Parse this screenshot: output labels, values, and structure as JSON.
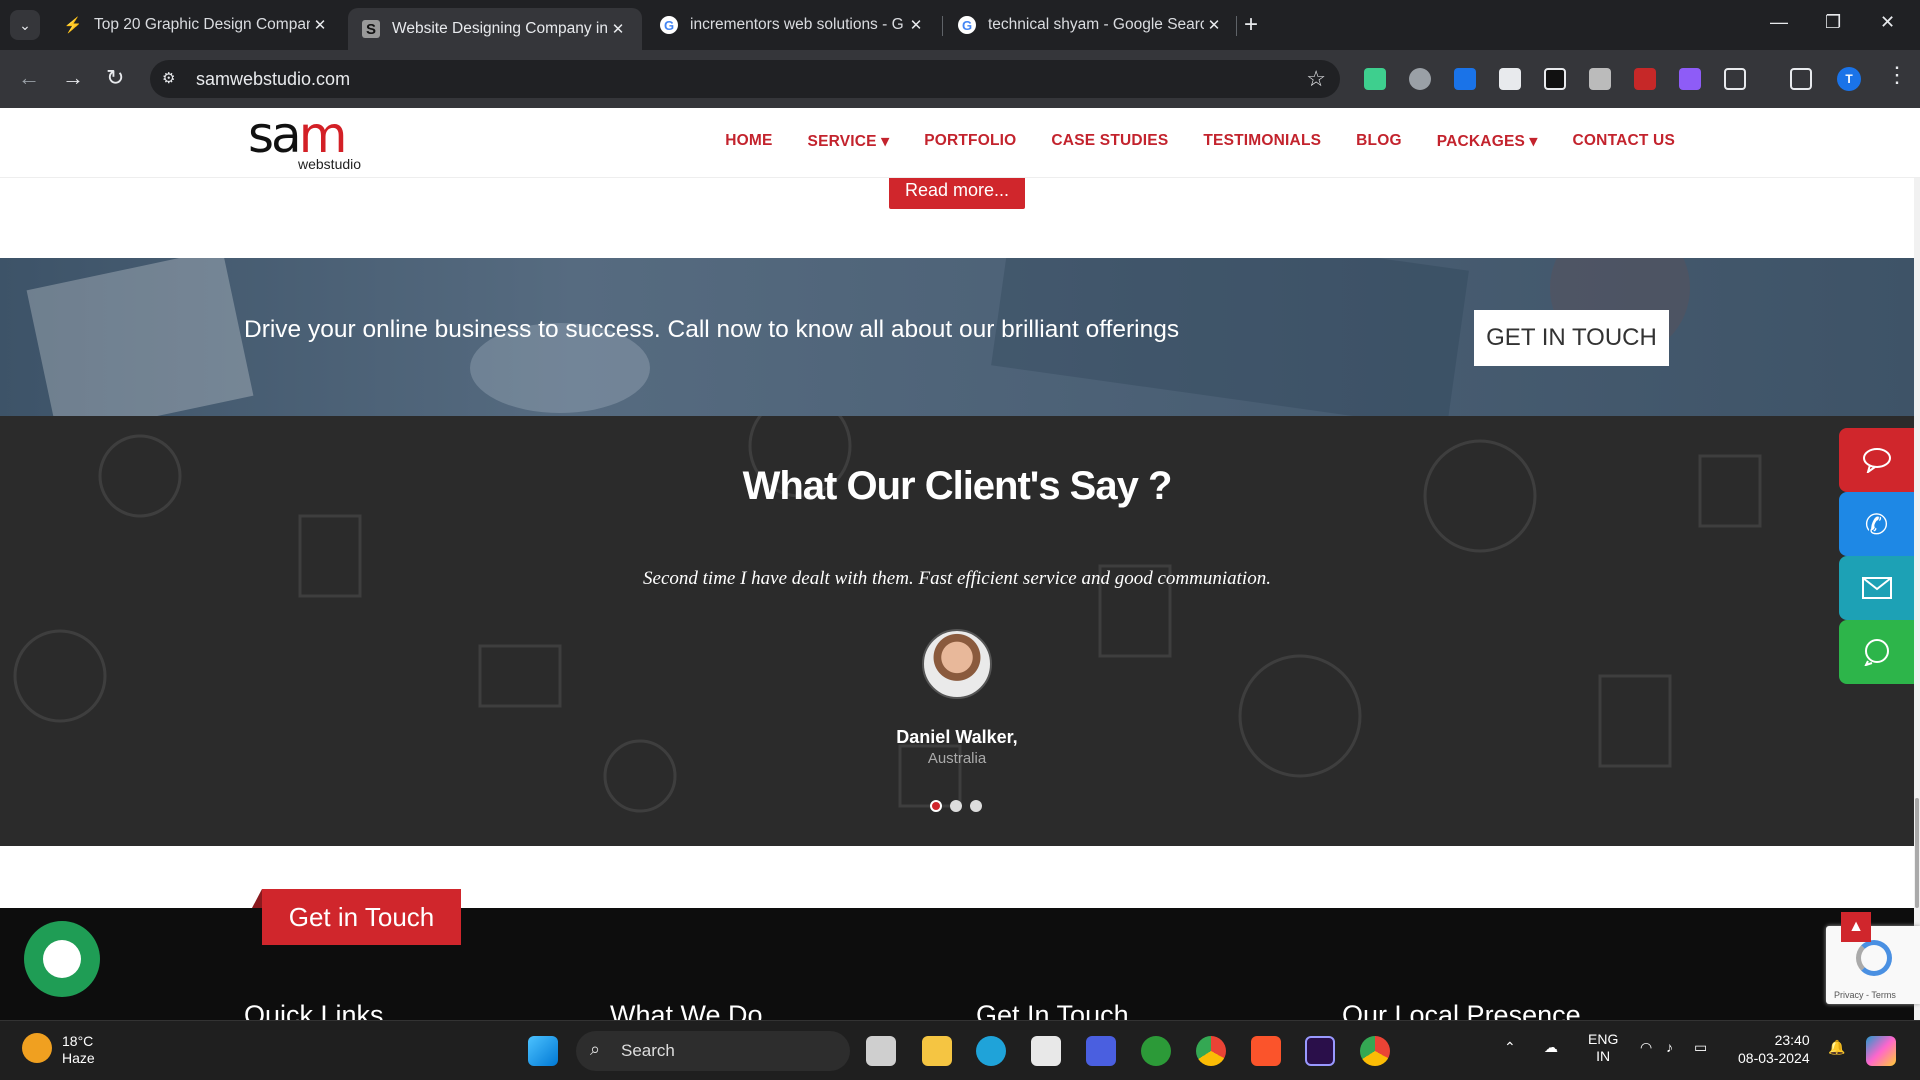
{
  "browser": {
    "tabs": [
      {
        "title": "Top 20 Graphic Design Compan",
        "active": false
      },
      {
        "title": "Website Designing Company in",
        "active": true
      },
      {
        "title": "incrementors web solutions - G",
        "active": false
      },
      {
        "title": "technical shyam - Google Searc",
        "active": false
      }
    ],
    "url": "samwebstudio.com",
    "profile_initial": "T"
  },
  "site": {
    "logo_main_a": "sa",
    "logo_main_b": "m",
    "logo_sub": "webstudio",
    "nav": [
      "HOME",
      "SERVICE ▾",
      "PORTFOLIO",
      "CASE STUDIES",
      "TESTIMONIALS",
      "BLOG",
      "PACKAGES ▾",
      "CONTACT US"
    ],
    "read_more": "Read more...",
    "cta_text": "Drive your online business to success. Call now to know all about our brilliant offerings",
    "cta_button": "GET IN TOUCH",
    "testimonials": {
      "heading_a": "What Our ",
      "heading_b": "Client's",
      "heading_c": " Say ?",
      "quote": "Second time I have dealt with them. Fast efficient service and good communiation.",
      "name": "Daniel Walker,",
      "location": "Australia",
      "active_dot": 1,
      "dot_count": 3
    },
    "footer": {
      "get_in_touch_tab": "Get in Touch",
      "columns": [
        "Quick Links",
        "What We Do",
        "Get In Touch",
        "Our Local Presence"
      ]
    },
    "recaptcha_links": "Privacy - Terms"
  },
  "taskbar": {
    "temperature": "18°C",
    "weather": "Haze",
    "search": "Search",
    "lang_a": "ENG",
    "lang_b": "IN",
    "time": "23:40",
    "date": "08-03-2024"
  },
  "colors": {
    "brand_red": "#d0262c",
    "call_blue": "#1e88e5",
    "mail_teal": "#1da1b5",
    "whatsapp_green": "#2db54a"
  }
}
